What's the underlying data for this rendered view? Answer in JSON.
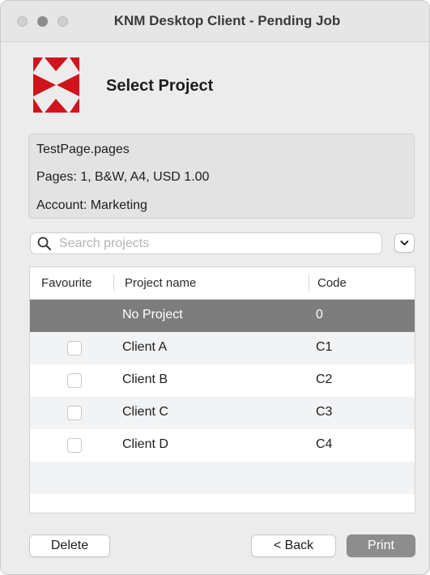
{
  "window": {
    "title": "KNM Desktop Client - Pending Job"
  },
  "header": {
    "title": "Select Project"
  },
  "job": {
    "filename": "TestPage.pages",
    "details": "Pages: 1, B&W, A4, USD 1.00",
    "account": "Account: Marketing"
  },
  "search": {
    "placeholder": "Search projects",
    "value": ""
  },
  "table": {
    "columns": [
      "Favourite",
      "Project name",
      "Code"
    ],
    "rows": [
      {
        "name": "No Project",
        "code": "0",
        "has_checkbox": false,
        "selected": true
      },
      {
        "name": "Client A",
        "code": "C1",
        "has_checkbox": true,
        "checked": false
      },
      {
        "name": "Client B",
        "code": "C2",
        "has_checkbox": true,
        "checked": false
      },
      {
        "name": "Client C",
        "code": "C3",
        "has_checkbox": true,
        "checked": false
      },
      {
        "name": "Client D",
        "code": "C4",
        "has_checkbox": true,
        "checked": false
      }
    ]
  },
  "buttons": {
    "delete": "Delete",
    "back": "< Back",
    "print": "Print"
  },
  "colors": {
    "brand_red": "#d0141c",
    "selected_row": "#7d7d7d",
    "primary_button": "#8d8d8d"
  }
}
